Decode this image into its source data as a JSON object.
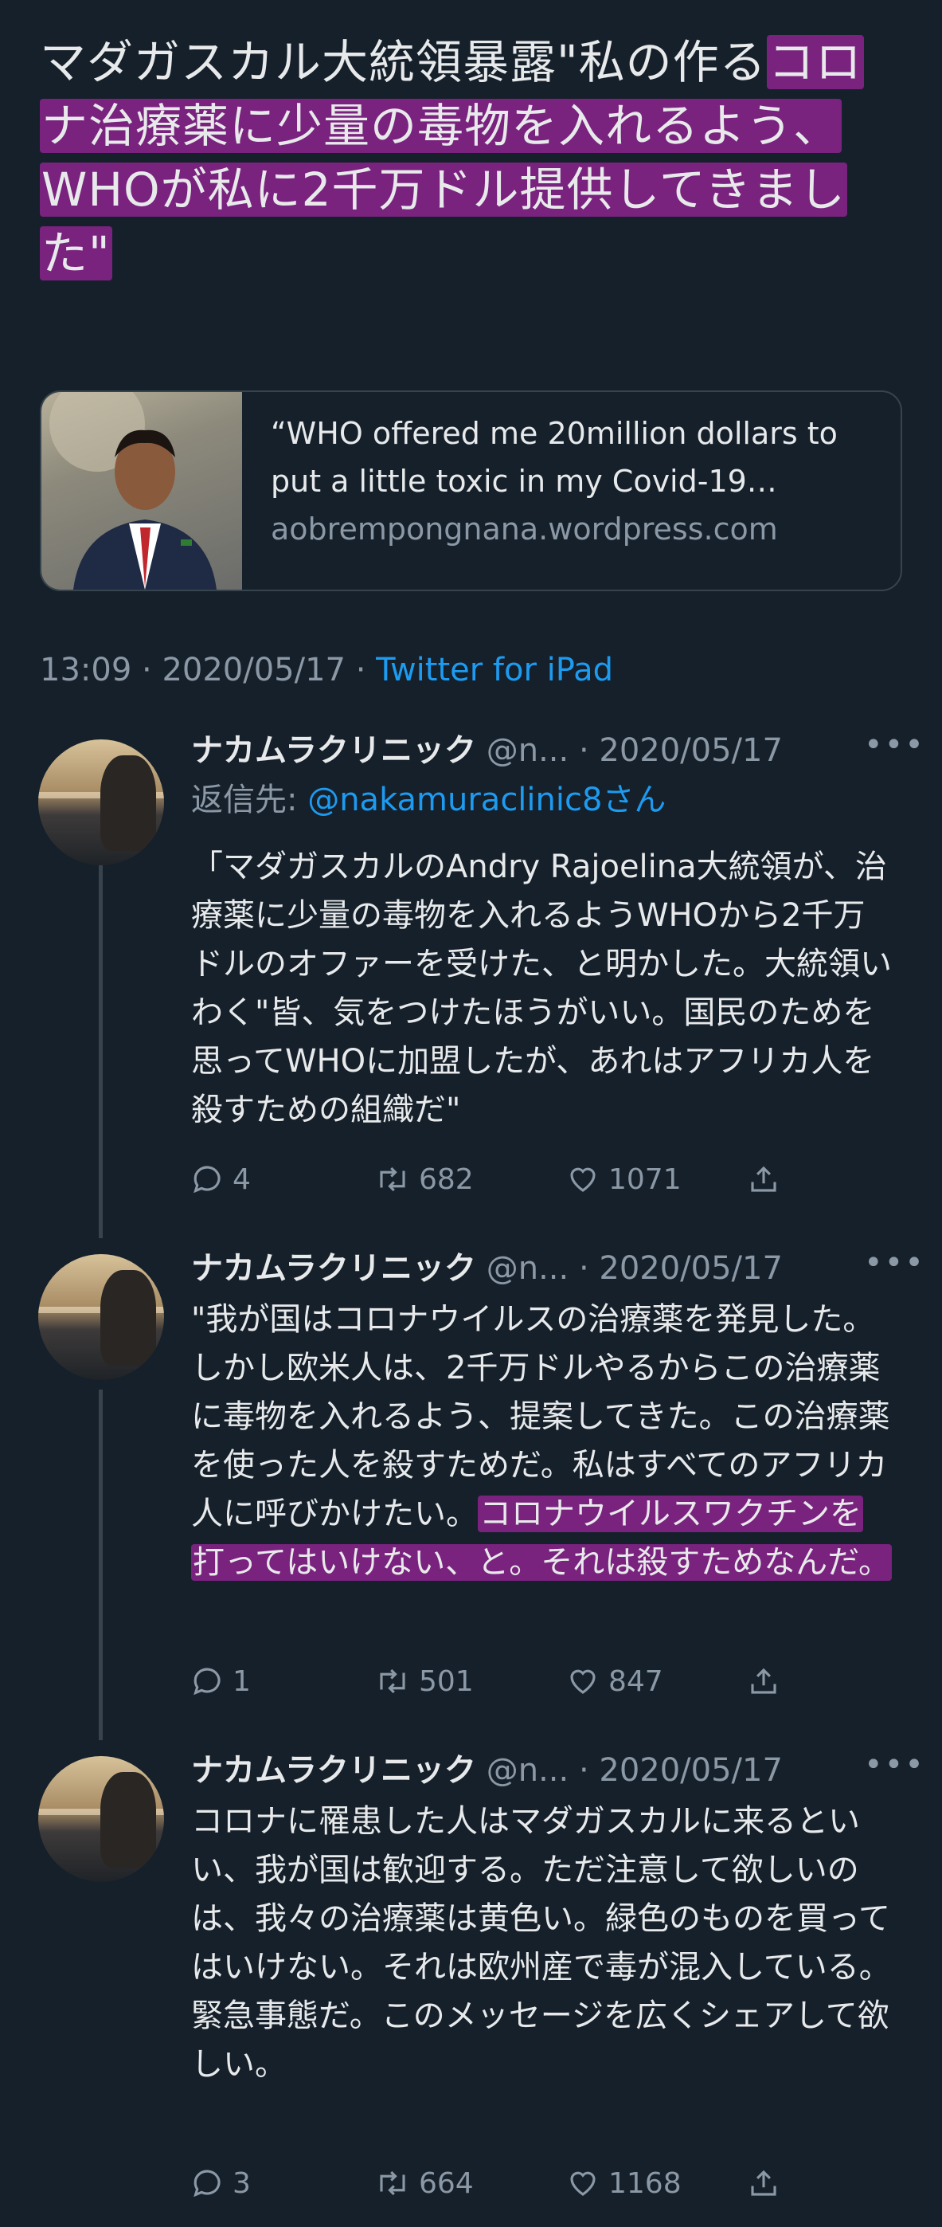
{
  "main_tweet": {
    "text_plain": "マダガスカル大統領暴露\"私の作る",
    "text_highlight": "コロナ治療薬に少量の毒物を入れるよう、WHOが私に2千万ドル提供してきました\"",
    "highlight_color": "#962396"
  },
  "link_card": {
    "title": "“WHO offered me 20million dollars to put a little toxic in my Covid-19…",
    "domain": "aobrempongnana.wordpress.com"
  },
  "meta": {
    "time": "13:09",
    "separator": "·",
    "date": "2020/05/17",
    "source": "Twitter for iPad"
  },
  "replies": [
    {
      "name": "ナカムラクリニック",
      "handle": "@n...",
      "date": "· 2020/05/17",
      "more": "•••",
      "reply_to_prefix": "返信先: ",
      "reply_to_mention": "@nakamuraclinic8さん",
      "text_plain": "「マダガスカルのAndry Rajoelina大統領が、治療薬に少量の毒物を入れるようWHOから2千万ドルのオファーを受けた、と明かした。大統領いわく\"皆、気をつけたほうがいい。国民のためを思ってWHOに加盟したが、あれはアフリカ人を殺すための組織だ\"",
      "text_highlight": "",
      "replies": "4",
      "retweets": "682",
      "likes": "1071"
    },
    {
      "name": "ナカムラクリニック",
      "handle": "@n...",
      "date": "· 2020/05/17",
      "more": "•••",
      "text_plain": "\"我が国はコロナウイルスの治療薬を発見した。しかし欧米人は、2千万ドルやるからこの治療薬に毒物を入れるよう、提案してきた。この治療薬を使った人を殺すためだ。私はすべてのアフリカ人に呼びかけたい。",
      "text_highlight": "コロナウイルスワクチンを打ってはいけない、と。それは殺すためなんだ。",
      "replies": "1",
      "retweets": "501",
      "likes": "847"
    },
    {
      "name": "ナカムラクリニック",
      "handle": "@n...",
      "date": "· 2020/05/17",
      "more": "•••",
      "text_plain": "コロナに罹患した人はマダガスカルに来るといい、我が国は歓迎する。ただ注意して欲しいのは、我々の治療薬は黄色い。緑色のものを買ってはいけない。それは欧州産で毒が混入している。\n緊急事態だ。このメッセージを広くシェアして欲しい。",
      "text_highlight": "",
      "replies": "3",
      "retweets": "664",
      "likes": "1168"
    }
  ],
  "icons": {
    "reply": "reply-icon",
    "retweet": "retweet-icon",
    "like": "like-icon",
    "share": "share-icon"
  },
  "colors": {
    "background": "#15202b",
    "text": "#e7e9ea",
    "muted": "#8b98a5",
    "link": "#1d9bf0"
  }
}
